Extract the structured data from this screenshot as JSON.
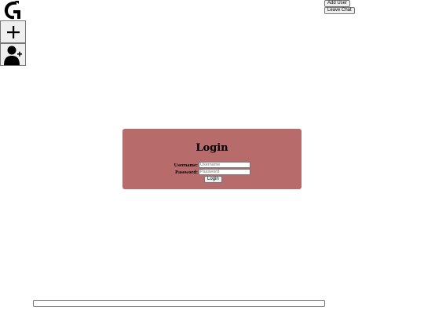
{
  "app": {
    "logo_icon": "g-logo-icon"
  },
  "toolbar": {
    "new_chat_icon": "plus-icon",
    "add_user_icon": "add-user-icon",
    "add_user_label": "Add User",
    "leave_chat_label": "Leave Chat"
  },
  "login": {
    "title": "Login",
    "username_label": "Username:",
    "username_placeholder": "Username",
    "username_value": "",
    "password_label": "Password:",
    "password_placeholder": "Password",
    "password_value": "",
    "submit_label": "Login",
    "panel_color": "#b86b6b"
  },
  "composer": {
    "message_value": "",
    "message_placeholder": ""
  }
}
